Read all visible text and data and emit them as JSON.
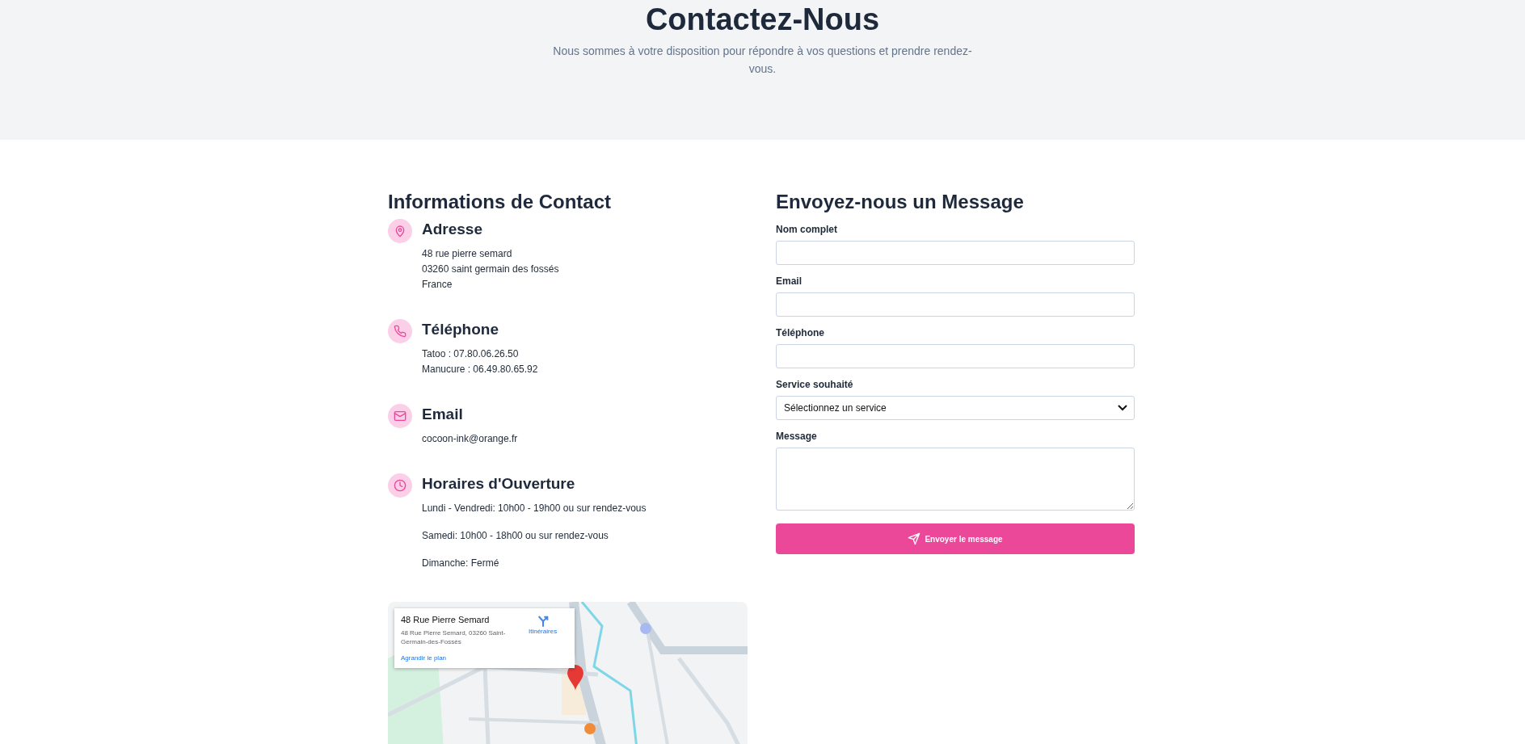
{
  "header": {
    "title": "Contactez-Nous",
    "subtitle": "Nous sommes à votre disposition pour répondre à vos questions et prendre rendez-vous."
  },
  "contact": {
    "heading": "Informations de Contact",
    "items": [
      {
        "kind": "address",
        "title": "Adresse",
        "lines": [
          "48 rue pierre semard",
          "03260 saint germain des fossés",
          "France"
        ]
      },
      {
        "kind": "phone",
        "title": "Téléphone",
        "lines": [
          "Tatoo : 07.80.06.26.50",
          "Manucure : 06.49.80.65.92"
        ]
      },
      {
        "kind": "email",
        "title": "Email",
        "lines": [
          "cocoon-ink@orange.fr"
        ]
      },
      {
        "kind": "hours",
        "title": "Horaires d'Ouverture",
        "lines": [
          "Lundi - Vendredi: 10h00 - 19h00 ou sur rendez-vous",
          "Samedi: 10h00 - 18h00 ou sur rendez-vous",
          "Dimanche: Fermé"
        ]
      }
    ]
  },
  "map": {
    "card": {
      "title": "48 Rue Pierre Semard",
      "address": "48 Rue Pierre Semard, 03260 Saint-Germain-des-Fossés",
      "directions": "Itinéraires",
      "enlarge": "Agrandir le plan"
    }
  },
  "form": {
    "heading": "Envoyez-nous un Message",
    "fields": [
      {
        "kind": "text",
        "label": "Nom complet"
      },
      {
        "kind": "text",
        "label": "Email"
      },
      {
        "kind": "text",
        "label": "Téléphone"
      },
      {
        "kind": "select",
        "label": "Service souhaité",
        "value": "Sélectionnez un service"
      },
      {
        "kind": "textarea",
        "label": "Message"
      }
    ],
    "submit": "Envoyer le message"
  }
}
